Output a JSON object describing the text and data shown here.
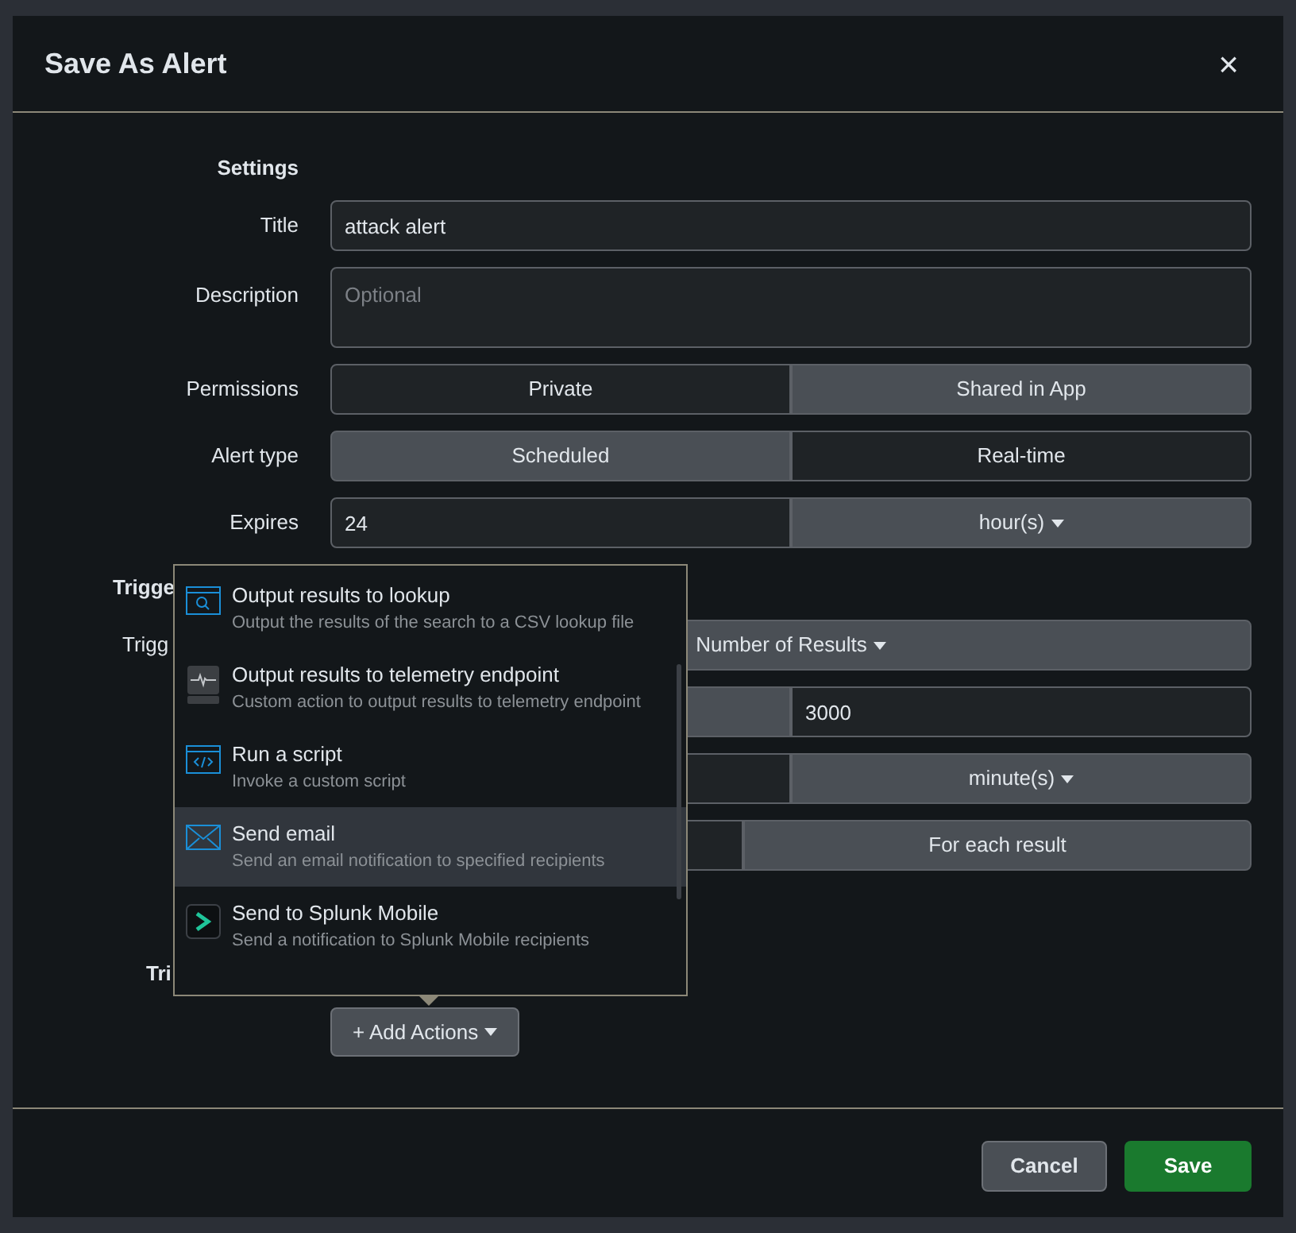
{
  "dialog": {
    "title": "Save As Alert",
    "close": "×"
  },
  "settings": {
    "heading": "Settings",
    "title": {
      "label": "Title",
      "value": "attack alert"
    },
    "description": {
      "label": "Description",
      "placeholder": "Optional"
    },
    "permissions": {
      "label": "Permissions",
      "options": [
        {
          "label": "Private",
          "selected": true
        },
        {
          "label": "Shared in App",
          "selected": false
        }
      ]
    },
    "alert_type": {
      "label": "Alert type",
      "options": [
        {
          "label": "Scheduled",
          "selected": false
        },
        {
          "label": "Real-time",
          "selected": true
        }
      ]
    },
    "expires": {
      "label": "Expires",
      "value": "24",
      "unit": "hour(s)"
    }
  },
  "trigger_conditions": {
    "heading": "Trigge",
    "trigger_label": "Trigg",
    "trigger_value": "Number of Results",
    "threshold": "3000",
    "window_unit": "minute(s)",
    "mode_options": [
      {
        "selected": true
      },
      {
        "label": "For each result",
        "selected": false
      }
    ]
  },
  "trigger_actions": {
    "label": "Tri",
    "button": "+ Add Actions"
  },
  "actions_menu": [
    {
      "kind": "lookup",
      "title": "Output results to lookup",
      "description": "Output the results of the search to a CSV lookup file",
      "selected": false
    },
    {
      "kind": "telemetry",
      "title": "Output results to telemetry endpoint",
      "description": "Custom action to output results to telemetry endpoint",
      "selected": false
    },
    {
      "kind": "script",
      "title": "Run a script",
      "description": "Invoke a custom script",
      "selected": false
    },
    {
      "kind": "email",
      "title": "Send email",
      "description": "Send an email notification to specified recipients",
      "selected": true
    },
    {
      "kind": "mobile",
      "title": "Send to Splunk Mobile",
      "description": "Send a notification to Splunk Mobile recipients",
      "selected": false
    }
  ],
  "footer": {
    "cancel": "Cancel",
    "save": "Save"
  }
}
